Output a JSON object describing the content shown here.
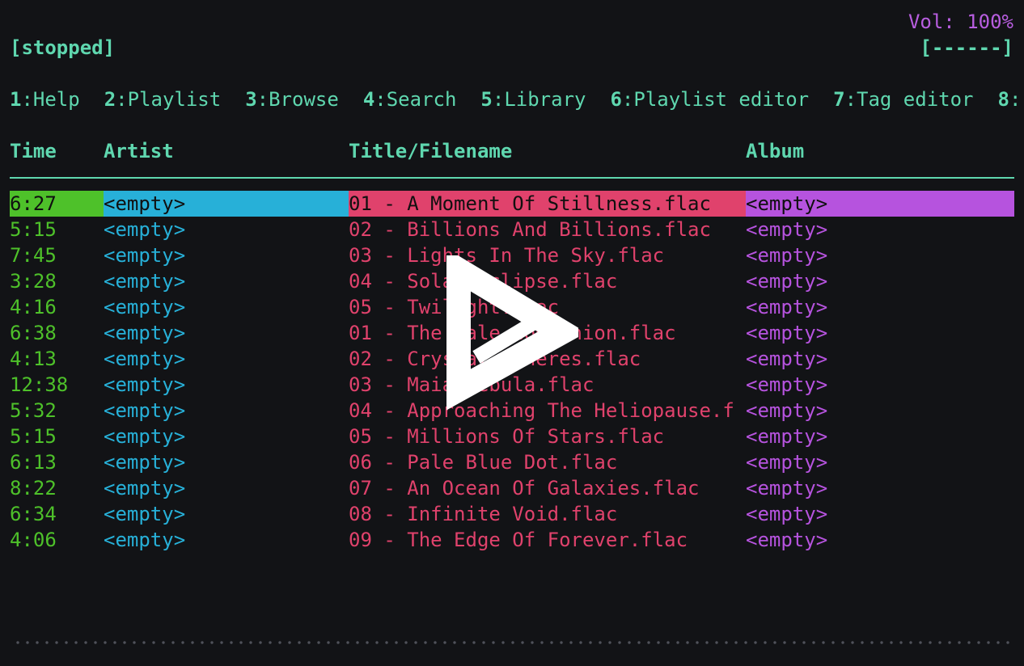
{
  "header": {
    "volume": "Vol: 100%",
    "state": "[stopped]",
    "progress": "[------]"
  },
  "tabs": [
    {
      "num": "1",
      "label": ":Help"
    },
    {
      "num": "2",
      "label": ":Playlist"
    },
    {
      "num": "3",
      "label": ":Browse"
    },
    {
      "num": "4",
      "label": ":Search"
    },
    {
      "num": "5",
      "label": ":Library"
    },
    {
      "num": "6",
      "label": ":Playlist editor"
    },
    {
      "num": "7",
      "label": ":Tag editor"
    },
    {
      "num": "8",
      "label": ":"
    }
  ],
  "columns": {
    "time": "Time",
    "artist": "Artist",
    "title": "Title/Filename",
    "album": "Album"
  },
  "rows": [
    {
      "time": "6:27",
      "artist": "<empty>",
      "title": "01 - A Moment Of Stillness.flac",
      "album": "<empty>",
      "selected": true
    },
    {
      "time": "5:15",
      "artist": "<empty>",
      "title": "02 - Billions And Billions.flac",
      "album": "<empty>"
    },
    {
      "time": "7:45",
      "artist": "<empty>",
      "title": "03 - Lights In The Sky.flac",
      "album": "<empty>"
    },
    {
      "time": "3:28",
      "artist": "<empty>",
      "title": "04 - Solar Eclipse.flac",
      "album": "<empty>"
    },
    {
      "time": "4:16",
      "artist": "<empty>",
      "title": "05 - Twilight.flac",
      "album": "<empty>"
    },
    {
      "time": "6:38",
      "artist": "<empty>",
      "title": "01 - The Pale Companion.flac",
      "album": "<empty>"
    },
    {
      "time": "4:13",
      "artist": "<empty>",
      "title": "02 - Crystal Spheres.flac",
      "album": "<empty>"
    },
    {
      "time": "12:38",
      "artist": "<empty>",
      "title": "03 - Maia Nebula.flac",
      "album": "<empty>"
    },
    {
      "time": "5:32",
      "artist": "<empty>",
      "title": "04 - Approaching The Heliopause.f",
      "album": "<empty>"
    },
    {
      "time": "5:15",
      "artist": "<empty>",
      "title": "05 - Millions Of Stars.flac",
      "album": "<empty>"
    },
    {
      "time": "6:13",
      "artist": "<empty>",
      "title": "06 - Pale Blue Dot.flac",
      "album": "<empty>"
    },
    {
      "time": "8:22",
      "artist": "<empty>",
      "title": "07 - An Ocean Of Galaxies.flac",
      "album": "<empty>"
    },
    {
      "time": "6:34",
      "artist": "<empty>",
      "title": "08 - Infinite Void.flac",
      "album": "<empty>"
    },
    {
      "time": "4:06",
      "artist": "<empty>",
      "title": "09 - The Edge Of Forever.flac",
      "album": "<empty>"
    }
  ],
  "colors": {
    "background": "#121316",
    "accent": "#5fd7af",
    "time": "#4ec12a",
    "artist": "#27b0d8",
    "title": "#e0426c",
    "album": "#b653de",
    "volume": "#b85ee0"
  },
  "overlay": {
    "icon": "play-logo-icon"
  }
}
